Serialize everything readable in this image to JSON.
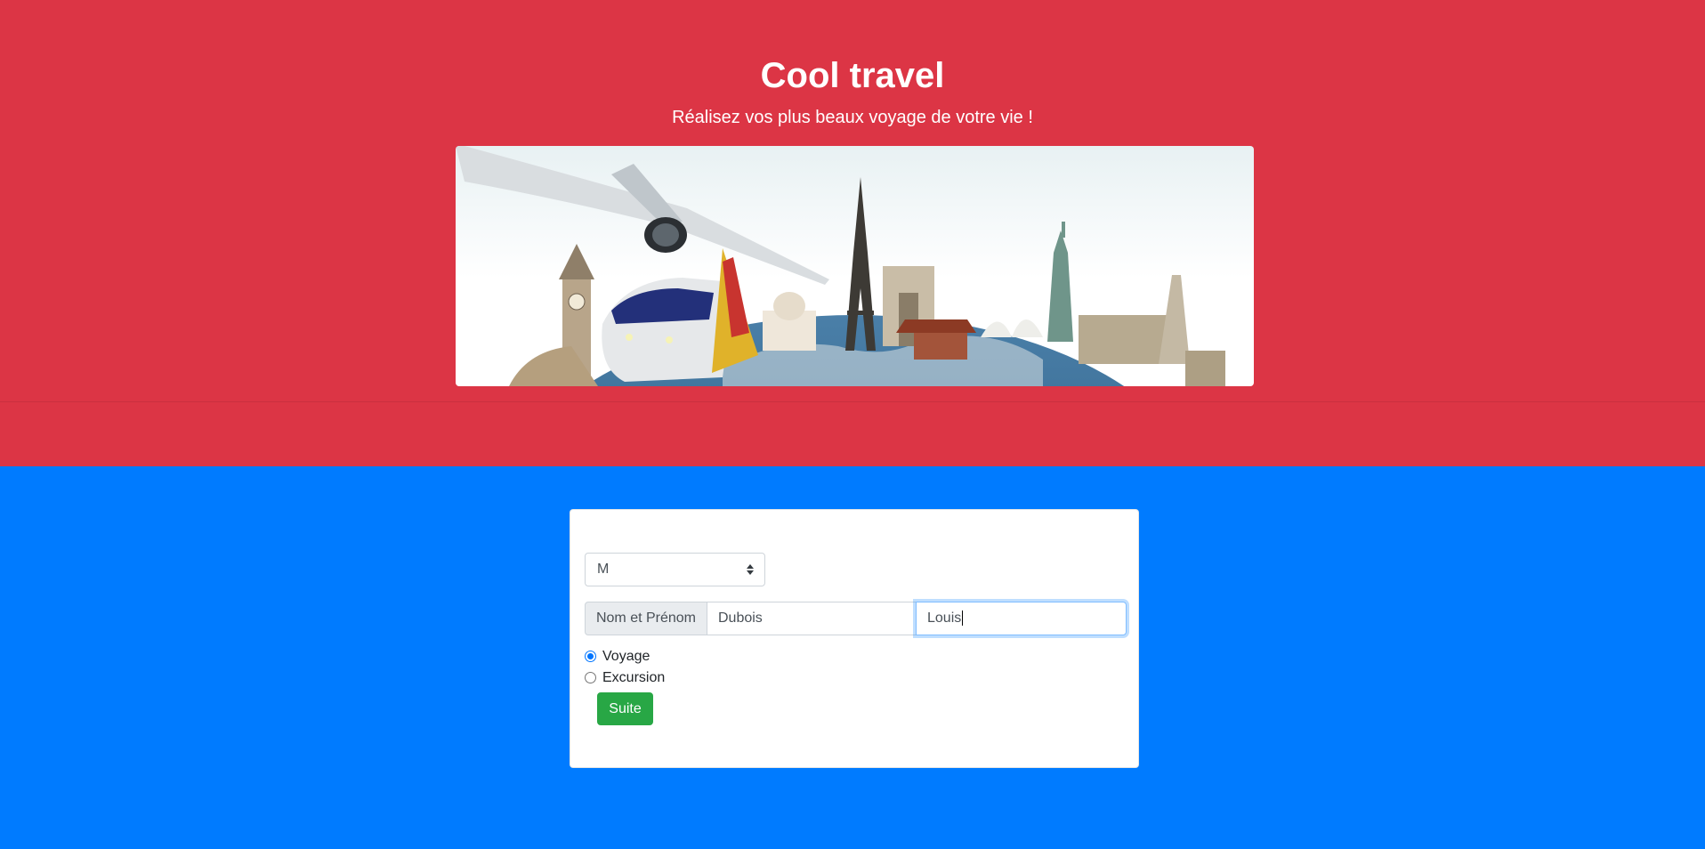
{
  "header": {
    "title": "Cool travel",
    "subtitle": "Réalisez vos plus beaux voyage de votre vie !"
  },
  "colors": {
    "header_bg": "#dc3545",
    "main_bg": "#007bff",
    "button_bg": "#28a745"
  },
  "form": {
    "civility": {
      "selected": "M",
      "icon": "select-arrows-icon"
    },
    "name_group": {
      "label": "Nom et Prénom",
      "nom_value": "Dubois",
      "prenom_value": "Louis"
    },
    "trip_type": {
      "options": [
        {
          "label": "Voyage",
          "checked": true
        },
        {
          "label": "Excursion",
          "checked": false
        }
      ]
    },
    "submit_label": "Suite"
  }
}
